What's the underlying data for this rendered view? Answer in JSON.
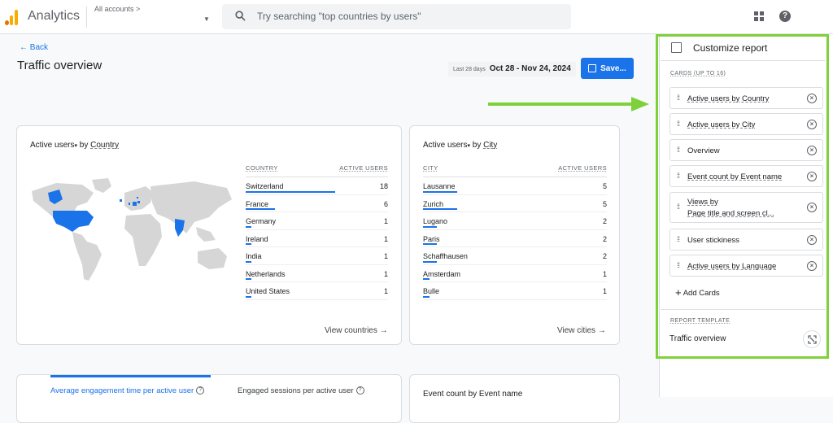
{
  "header": {
    "app_title": "Analytics",
    "account": "All accounts >",
    "search_placeholder": "Try searching \"top countries by users\""
  },
  "page": {
    "back_label": "Back",
    "title": "Traffic overview",
    "date_label": "Last 28 days",
    "date_value": "Oct 28 - Nov 24, 2024",
    "save_label": "Save..."
  },
  "country_card": {
    "title_metric": "Active users",
    "title_by": "by",
    "title_dim": "Country",
    "col_dim": "COUNTRY",
    "col_metric": "ACTIVE USERS",
    "rows": [
      {
        "name": "Switzerland",
        "value": "18",
        "share": 1.0
      },
      {
        "name": "France",
        "value": "6",
        "share": 0.33
      },
      {
        "name": "Germany",
        "value": "1",
        "share": 0.06
      },
      {
        "name": "Ireland",
        "value": "1",
        "share": 0.06
      },
      {
        "name": "India",
        "value": "1",
        "share": 0.06
      },
      {
        "name": "Netherlands",
        "value": "1",
        "share": 0.06
      },
      {
        "name": "United States",
        "value": "1",
        "share": 0.06
      }
    ],
    "view_link": "View countries"
  },
  "city_card": {
    "title_metric": "Active users",
    "title_by": "by",
    "title_dim": "City",
    "col_dim": "CITY",
    "col_metric": "ACTIVE USERS",
    "rows": [
      {
        "name": "Lausanne",
        "value": "5",
        "share": 1.0
      },
      {
        "name": "Zurich",
        "value": "5",
        "share": 1.0
      },
      {
        "name": "Lugano",
        "value": "2",
        "share": 0.4
      },
      {
        "name": "Paris",
        "value": "2",
        "share": 0.4
      },
      {
        "name": "Schaffhausen",
        "value": "2",
        "share": 0.4
      },
      {
        "name": "Amsterdam",
        "value": "1",
        "share": 0.2
      },
      {
        "name": "Bulle",
        "value": "1",
        "share": 0.2
      }
    ],
    "view_link": "View cities"
  },
  "bottom": {
    "tab_active": "Average engagement time per active user",
    "tab_other": "Engaged sessions per active user",
    "event_card_title": "Event count by Event name"
  },
  "customize": {
    "title": "Customize report",
    "cards_label": "CARDS (UP TO 16)",
    "cards": [
      {
        "line1": "Active users by Country",
        "line2": "",
        "dashed": true
      },
      {
        "line1": "Active users by City",
        "line2": "",
        "dashed": true
      },
      {
        "line1": "Overview",
        "line2": "",
        "dashed": false
      },
      {
        "line1": "Event count by Event name",
        "line2": "",
        "dashed": true
      },
      {
        "line1": "Views by",
        "line2": "Page title and screen cl...",
        "dashed": true
      },
      {
        "line1": "User stickiness",
        "line2": "",
        "dashed": false
      },
      {
        "line1": "Active users by Language",
        "line2": "",
        "dashed": true
      }
    ],
    "add_cards": "Add Cards",
    "template_label": "REPORT TEMPLATE",
    "template_name": "Traffic overview"
  },
  "colors": {
    "accent": "#1a73e8",
    "highlight": "#7ed13b",
    "map_base": "#d6d6d6"
  }
}
